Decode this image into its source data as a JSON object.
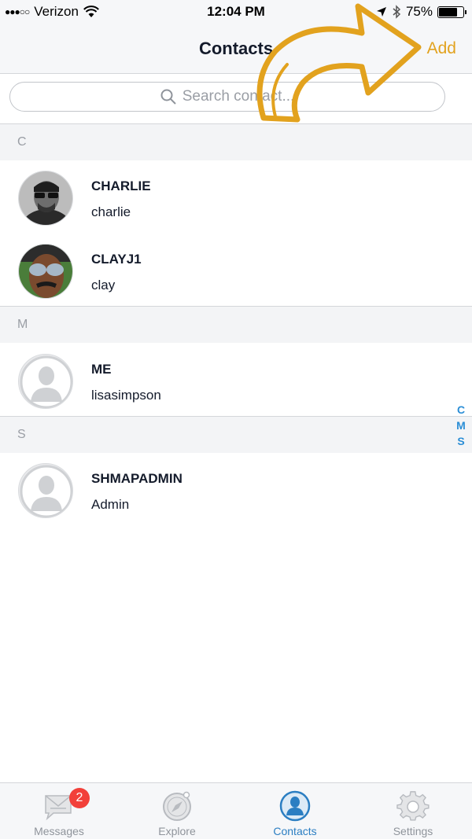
{
  "status_bar": {
    "signal": "●●●○○",
    "carrier": "Verizon",
    "time": "12:04 PM",
    "battery_percent": "75%",
    "battery_level": 0.75,
    "icons": [
      "wifi-icon",
      "location-arrow-icon",
      "bluetooth-icon",
      "battery-icon"
    ]
  },
  "nav": {
    "title": "Contacts",
    "add_label": "Add",
    "accent_color": "#e2a21e"
  },
  "search": {
    "placeholder": "Search contact..."
  },
  "sections": [
    {
      "letter": "C",
      "contacts": [
        {
          "name": "CHARLIE",
          "subtitle": "charlie",
          "avatar": "photo"
        },
        {
          "name": "CLAYJ1",
          "subtitle": "clay",
          "avatar": "photo"
        }
      ]
    },
    {
      "letter": "M",
      "contacts": [
        {
          "name": "ME",
          "subtitle": "lisasimpson",
          "avatar": "placeholder"
        }
      ]
    },
    {
      "letter": "S",
      "contacts": [
        {
          "name": "SHMAPADMIN",
          "subtitle": "Admin",
          "avatar": "placeholder"
        }
      ]
    }
  ],
  "index": [
    "C",
    "M",
    "S"
  ],
  "tabs": [
    {
      "label": "Messages",
      "icon": "messages-icon",
      "badge": "2",
      "active": false
    },
    {
      "label": "Explore",
      "icon": "compass-icon",
      "active": false
    },
    {
      "label": "Contacts",
      "icon": "contacts-icon",
      "active": true
    },
    {
      "label": "Settings",
      "icon": "gear-icon",
      "active": false
    }
  ],
  "colors": {
    "tab_active": "#2b7ec2",
    "index": "#2b8ed6",
    "badge": "#f2403a",
    "annotation_arrow": "#e2a21e"
  }
}
